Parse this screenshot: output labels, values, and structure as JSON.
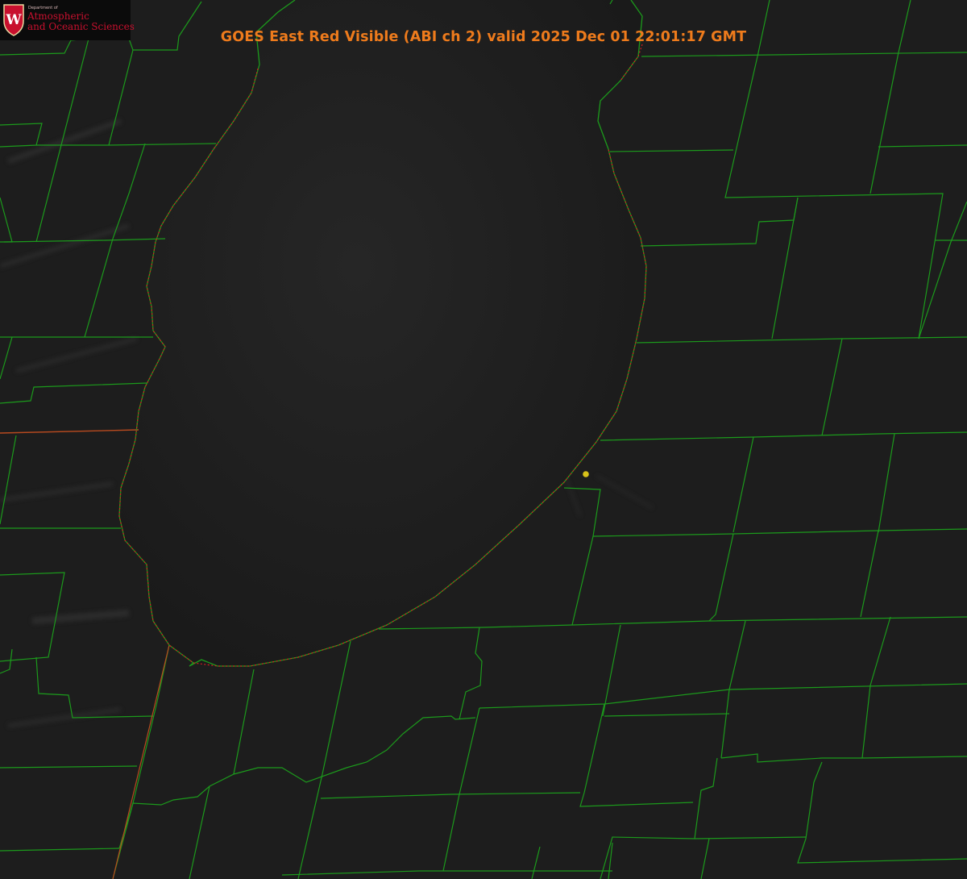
{
  "map": {
    "title": "GOES East Red Visible (ABI ch 2) valid 2025 Dec 01 22:01:17 GMT",
    "title_color": "#ee7b1c",
    "background_color": "#1d1d1d",
    "county_line_color": "#1c9a1c",
    "shoreline_color": "#d42020",
    "station_marker_color": "#d8c21a"
  },
  "logo": {
    "department_text": "Department of",
    "line1": "Atmospheric",
    "line2": "and Oceanic Sciences",
    "crest_letter": "W",
    "crest_color": "#c8102e",
    "text_color": "#c8102e"
  }
}
